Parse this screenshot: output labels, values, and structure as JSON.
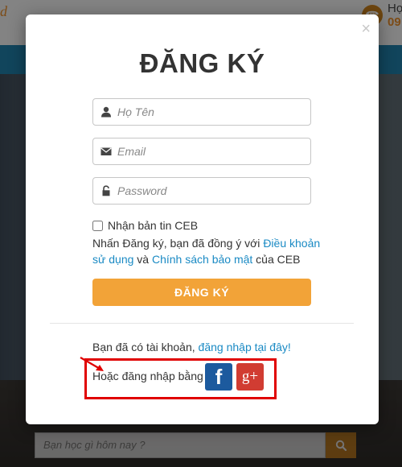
{
  "background": {
    "logo_text": "d",
    "phone_label": "Họ",
    "phone_number": "09",
    "search_placeholder": "Bạn học gì hôm nay ?"
  },
  "modal": {
    "close_label": "×",
    "title": "ĐĂNG KÝ",
    "fields": {
      "name_placeholder": "Họ Tên",
      "email_placeholder": "Email",
      "password_placeholder": "Password"
    },
    "newsletter_label": "Nhận bản tin CEB",
    "agree": {
      "prefix": "Nhấn Đăng ký, bạn đã đồng ý với ",
      "terms_link": "Điều khoản sử dụng",
      "middle": " và ",
      "privacy_link": "Chính sách bảo mật",
      "suffix": " của CEB"
    },
    "submit_label": "ĐĂNG KÝ",
    "have_account_prefix": "Bạn đã có tài khoản, ",
    "login_link": "đăng nhập tại đây!",
    "social_label": "Hoặc đăng nhập bằng",
    "facebook_glyph": "f",
    "google_glyph": "g+"
  },
  "colors": {
    "accent_orange": "#f2a338",
    "link_blue": "#1a8ac4",
    "facebook": "#1c5a9e",
    "google": "#d13c32",
    "highlight_red": "#e00000"
  }
}
